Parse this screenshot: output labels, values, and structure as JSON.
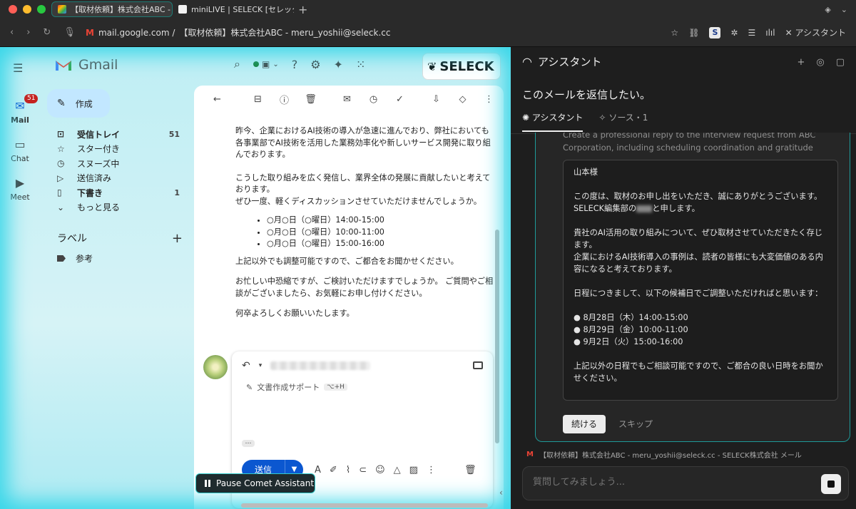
{
  "browser": {
    "tabs": [
      {
        "label": "【取材依頼】株式会社ABC - m"
      },
      {
        "label": "miniLIVE | SELECK [セレック]"
      }
    ],
    "url_host": "mail.google.com /",
    "url_title": "【取材依頼】株式会社ABC - meru_yoshii@seleck.cc",
    "assistant_toggle": "アシスタント"
  },
  "gmail": {
    "app_name": "Gmail",
    "rail": [
      {
        "label": "Mail",
        "badge": "51"
      },
      {
        "label": "Chat"
      },
      {
        "label": "Meet"
      }
    ],
    "compose": "作成",
    "nav": [
      {
        "label": "受信トレイ",
        "count": "51"
      },
      {
        "label": "スター付き",
        "count": ""
      },
      {
        "label": "スヌーズ中",
        "count": ""
      },
      {
        "label": "送信済み",
        "count": ""
      },
      {
        "label": "下書き",
        "count": "1"
      },
      {
        "label": "もっと見る",
        "count": ""
      }
    ],
    "labels_title": "ラベル",
    "labels": [
      {
        "label": "参考"
      }
    ],
    "seleck_logo": "SELECK",
    "body": {
      "p1": "昨今、企業におけるAI技術の導入が急速に進んでおり、弊社においても各事業部でAI技術を活用した業務効率化や新しいサービス開発に取り組んでおります。",
      "p2": "こうした取り組みを広く発信し、業界全体の発展に貢献したいと考えております。",
      "p3": "ぜひ一度、軽くディスカッションさせていただけませんでしょうか。",
      "slots": [
        "○月○日（○曜日）14:00-15:00",
        "○月○日（○曜日）10:00-11:00",
        "○月○日（○曜日）15:00-16:00"
      ],
      "p4": "上記以外でも調整可能ですので、ご都合をお聞かせください。",
      "p5": "お忙しい中恐縮ですが、ご検討いただけますでしょうか。 ご質問やご相談がございましたら、お気軽にお申し付けください。",
      "p6": "何卒よろしくお願いいたします。"
    },
    "reply": {
      "assist_label": "文書作成サポート",
      "assist_shortcut": "⌥+H",
      "send": "送信"
    },
    "pause_label": "Pause Comet Assistant"
  },
  "assistant": {
    "title": "アシスタント",
    "question": "このメールを返信したい。",
    "tabs": [
      {
        "label": "アシスタント"
      },
      {
        "label": "ソース・1"
      }
    ],
    "task_desc": "Create a professional reply to the interview request from ABC Corporation, including scheduling coordination and gratitude",
    "draft": {
      "l1": "山本様",
      "l2": "この度は、取材のお申し出をいただき、誠にありがとうございます。",
      "l3a": "SELECK編集部の",
      "l3b": "と申します。",
      "l4": "貴社のAI活用の取り組みについて、ぜひ取材させていただきたく存じます。",
      "l5": "企業におけるAI技術導入の事例は、読者の皆様にも大変価値のある内容になると考えております。",
      "l6": "日程につきまして、以下の候補日でご調整いただければと思います：",
      "dates": [
        "● 8月28日（木）14:00-15:00",
        "● 8月29日（金）10:00-11:00",
        "● 9月2日（火）15:00-16:00"
      ],
      "l7": "上記以外の日程でもご相談可能ですので、ご都合の良い日時をお聞かせください。"
    },
    "continue": "続ける",
    "skip": "スキップ",
    "source": "【取材依頼】株式会社ABC - meru_yoshii@seleck.cc - SELECK株式会社 メール",
    "input_placeholder": "質問してみましょう..."
  }
}
